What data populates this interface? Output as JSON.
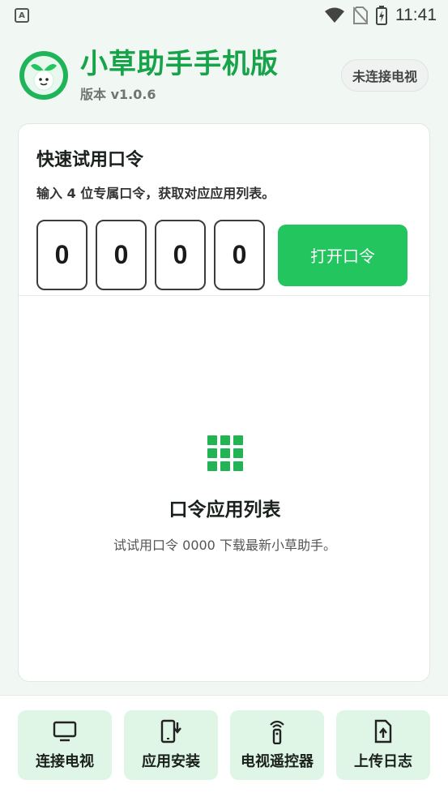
{
  "status_bar": {
    "time": "11:41",
    "left_icon": "A"
  },
  "header": {
    "title": "小草助手手机版",
    "version": "版本 v1.0.6",
    "tv_status": "未连接电视"
  },
  "quick_trial": {
    "title": "快速试用口令",
    "description": "输入 4 位专属口令，获取对应应用列表。",
    "digits": [
      "0",
      "0",
      "0",
      "0"
    ],
    "open_button": "打开口令"
  },
  "empty_state": {
    "icon": "grid-icon",
    "title": "口令应用列表",
    "subtitle": "试试用口令 0000 下载最新小草助手。"
  },
  "bottom_nav": {
    "items": [
      {
        "label": "连接电视",
        "icon": "tv-icon"
      },
      {
        "label": "应用安装",
        "icon": "phone-download-icon"
      },
      {
        "label": "电视遥控器",
        "icon": "remote-icon"
      },
      {
        "label": "上传日志",
        "icon": "file-upload-icon"
      }
    ]
  },
  "colors": {
    "brand": "#16a34a",
    "button": "#22c55e",
    "nav_bg": "#dff5e6",
    "page_bg": "#f1f7f2"
  }
}
